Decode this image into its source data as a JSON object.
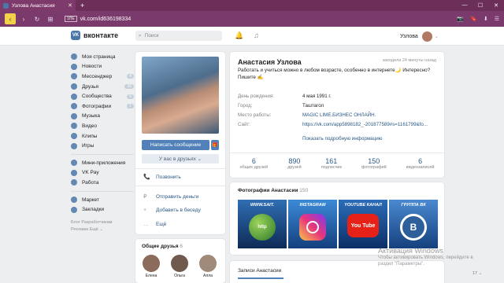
{
  "browser": {
    "tab_title": "Узлова Анастасия",
    "tab_close": "✕",
    "new_tab": "+",
    "win_controls": [
      "—",
      "☐",
      "✕"
    ],
    "back": "‹",
    "forward": "›",
    "reload": "↻",
    "grid": "⊞",
    "badge": "1ПЕ",
    "url": "vk.com/id636198334",
    "addr_icons": [
      "📷",
      "🔖",
      "⬇",
      "☰"
    ]
  },
  "header": {
    "logo_mark": "VK",
    "logo_text": "вконтакте",
    "search_placeholder": "Поиск",
    "bell": "🔔",
    "music": "♫",
    "user_name": "Узлова",
    "caret": "⌄"
  },
  "menu": {
    "items": [
      {
        "label": "Моя страница",
        "count": ""
      },
      {
        "label": "Новости",
        "count": ""
      },
      {
        "label": "Мессенджер",
        "count": "4"
      },
      {
        "label": "Друзья",
        "count": "16"
      },
      {
        "label": "Сообщества",
        "count": "5"
      },
      {
        "label": "Фотографии",
        "count": "1"
      },
      {
        "label": "Музыка",
        "count": ""
      },
      {
        "label": "Видео",
        "count": ""
      },
      {
        "label": "Клипы",
        "count": ""
      },
      {
        "label": "Игры",
        "count": ""
      }
    ],
    "items2": [
      {
        "label": "Мини-приложения"
      },
      {
        "label": "VK Pay"
      },
      {
        "label": "Работа"
      }
    ],
    "items3": [
      {
        "label": "Маркет"
      },
      {
        "label": "Закладки"
      }
    ],
    "footer_line1": "Блог  Разработчикам",
    "footer_line2": "Реклама  Ещё ⌄"
  },
  "avatar_card": {
    "send_message": "Написать сообщение",
    "gift_icon": "🎁",
    "in_friends": "У вас в друзьях ⌄",
    "actions": [
      {
        "icon": "📞",
        "label": "Позвонить"
      },
      {
        "icon": "₽",
        "label": "Отправить деньги"
      },
      {
        "icon": "+",
        "label": "Добавить в беседу"
      },
      {
        "icon": "…",
        "label": "Ещё"
      }
    ]
  },
  "friends_block": {
    "title": "Общие друзья",
    "count": "6",
    "names": [
      "Елена",
      "Ольга",
      "Алла"
    ]
  },
  "profile": {
    "name": "Анастасия Узлова",
    "online": "заходила 24 минуты назад",
    "status": "Работать и учиться можно в любом возрасте, особенно в интернете🌙 Интересно? Пишите ✍",
    "fields": [
      {
        "key": "День рождения:",
        "value": "4 мая 1991 г."
      },
      {
        "key": "Город:",
        "value": "Таштагол"
      },
      {
        "key": "Место работы:",
        "value": "MAGIC LIME.БИЗНЕС ОНЛАЙН."
      },
      {
        "key": "Сайт:",
        "value": "https://vk.com/app5898182_-201877589#s=1161799&fo..."
      }
    ],
    "show_more": "Показать подробную информацию",
    "stats": [
      {
        "n": "6",
        "l": "общих друзей"
      },
      {
        "n": "890",
        "l": "друзей"
      },
      {
        "n": "161",
        "l": "подписчик"
      },
      {
        "n": "150",
        "l": "фотографий"
      },
      {
        "n": "6",
        "l": "видеозаписей"
      }
    ]
  },
  "photos": {
    "title": "Фотографии Анастасии",
    "count": "150",
    "thumbs": [
      {
        "caption": "WWW.SAIT.",
        "glyph": "http"
      },
      {
        "caption": "INSTAGRAM",
        "glyph": ""
      },
      {
        "caption": "YOUTUBE КАНАЛ",
        "glyph": "You Tube"
      },
      {
        "caption": "ГРУППА ВК",
        "glyph": "B"
      }
    ]
  },
  "posts": {
    "title": "Записи Анастасии"
  },
  "watermark": {
    "line1": "Активация Windows",
    "line2": "Чтобы активировать Windows, перейдите в",
    "line3": "раздел \"Параметры\"."
  },
  "taskbar": "17 ⌄",
  "colors": {
    "accent": "#4a76a8",
    "browser_bar": "#7b3a6c",
    "link": "#2a5885"
  }
}
